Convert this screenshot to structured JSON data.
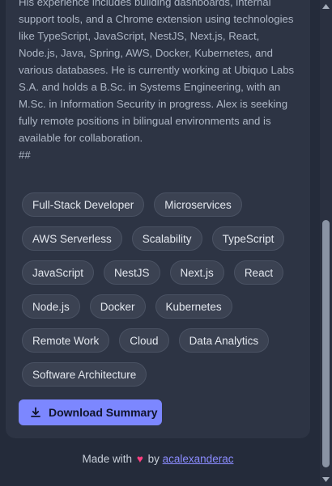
{
  "summary": {
    "text": "His experience includes building dashboards, internal support tools, and a Chrome extension using technologies like TypeScript, JavaScript, NestJS, Next.js, React, Node.js, Java, Spring, AWS, Docker, Kubernetes, and various databases. He is currently working at Ubiquo Labs S.A. and holds a B.Sc. in Systems Engineering, with an M.Sc. in Information Security in progress. Alex is seeking fully remote positions in bilingual environments and is available for collaboration.\n##"
  },
  "tags": [
    "Full-Stack Developer",
    "Microservices",
    "AWS Serverless",
    "Scalability",
    "TypeScript",
    "JavaScript",
    "NestJS",
    "Next.js",
    "React",
    "Node.js",
    "Docker",
    "Kubernetes",
    "Remote Work",
    "Cloud",
    "Data Analytics",
    "Software Architecture"
  ],
  "download_button": {
    "label": "Download Summary",
    "icon": "download-icon"
  },
  "footer": {
    "made_with": "Made with",
    "heart": "♥",
    "by": "by",
    "link": "acalexanderac"
  },
  "colors": {
    "background": "#242b3a",
    "card": "#2d3444",
    "accent": "#7c87ff",
    "heart": "#ff3d7f",
    "link": "#8b8cff"
  }
}
